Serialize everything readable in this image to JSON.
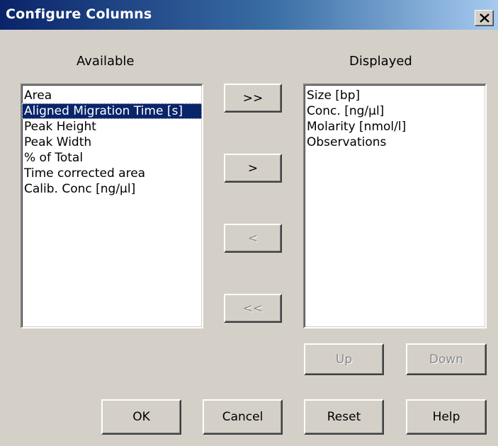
{
  "window": {
    "title": "Configure Columns",
    "close_symbol": "close-icon"
  },
  "available": {
    "label": "Available",
    "items": [
      "Area",
      "Aligned Migration Time [s]",
      "Peak Height",
      "Peak Width",
      "% of Total",
      "Time corrected area",
      "Calib. Conc [ng/µl]"
    ],
    "selected_index": 1
  },
  "displayed": {
    "label": "Displayed",
    "items": [
      "Size [bp]",
      "Conc. [ng/µl]",
      "Molarity [nmol/l]",
      "Observations"
    ]
  },
  "transfer_buttons": {
    "add_all": ">>",
    "add": ">",
    "remove": "<",
    "remove_all": "<<"
  },
  "order_buttons": {
    "up": "Up",
    "down": "Down"
  },
  "footer_buttons": {
    "ok": "OK",
    "cancel": "Cancel",
    "reset": "Reset",
    "help": "Help"
  },
  "colors": {
    "title_start": "#0a246a",
    "title_end": "#a6caf0",
    "face": "#d4d0c8",
    "selection": "#0a246a"
  }
}
